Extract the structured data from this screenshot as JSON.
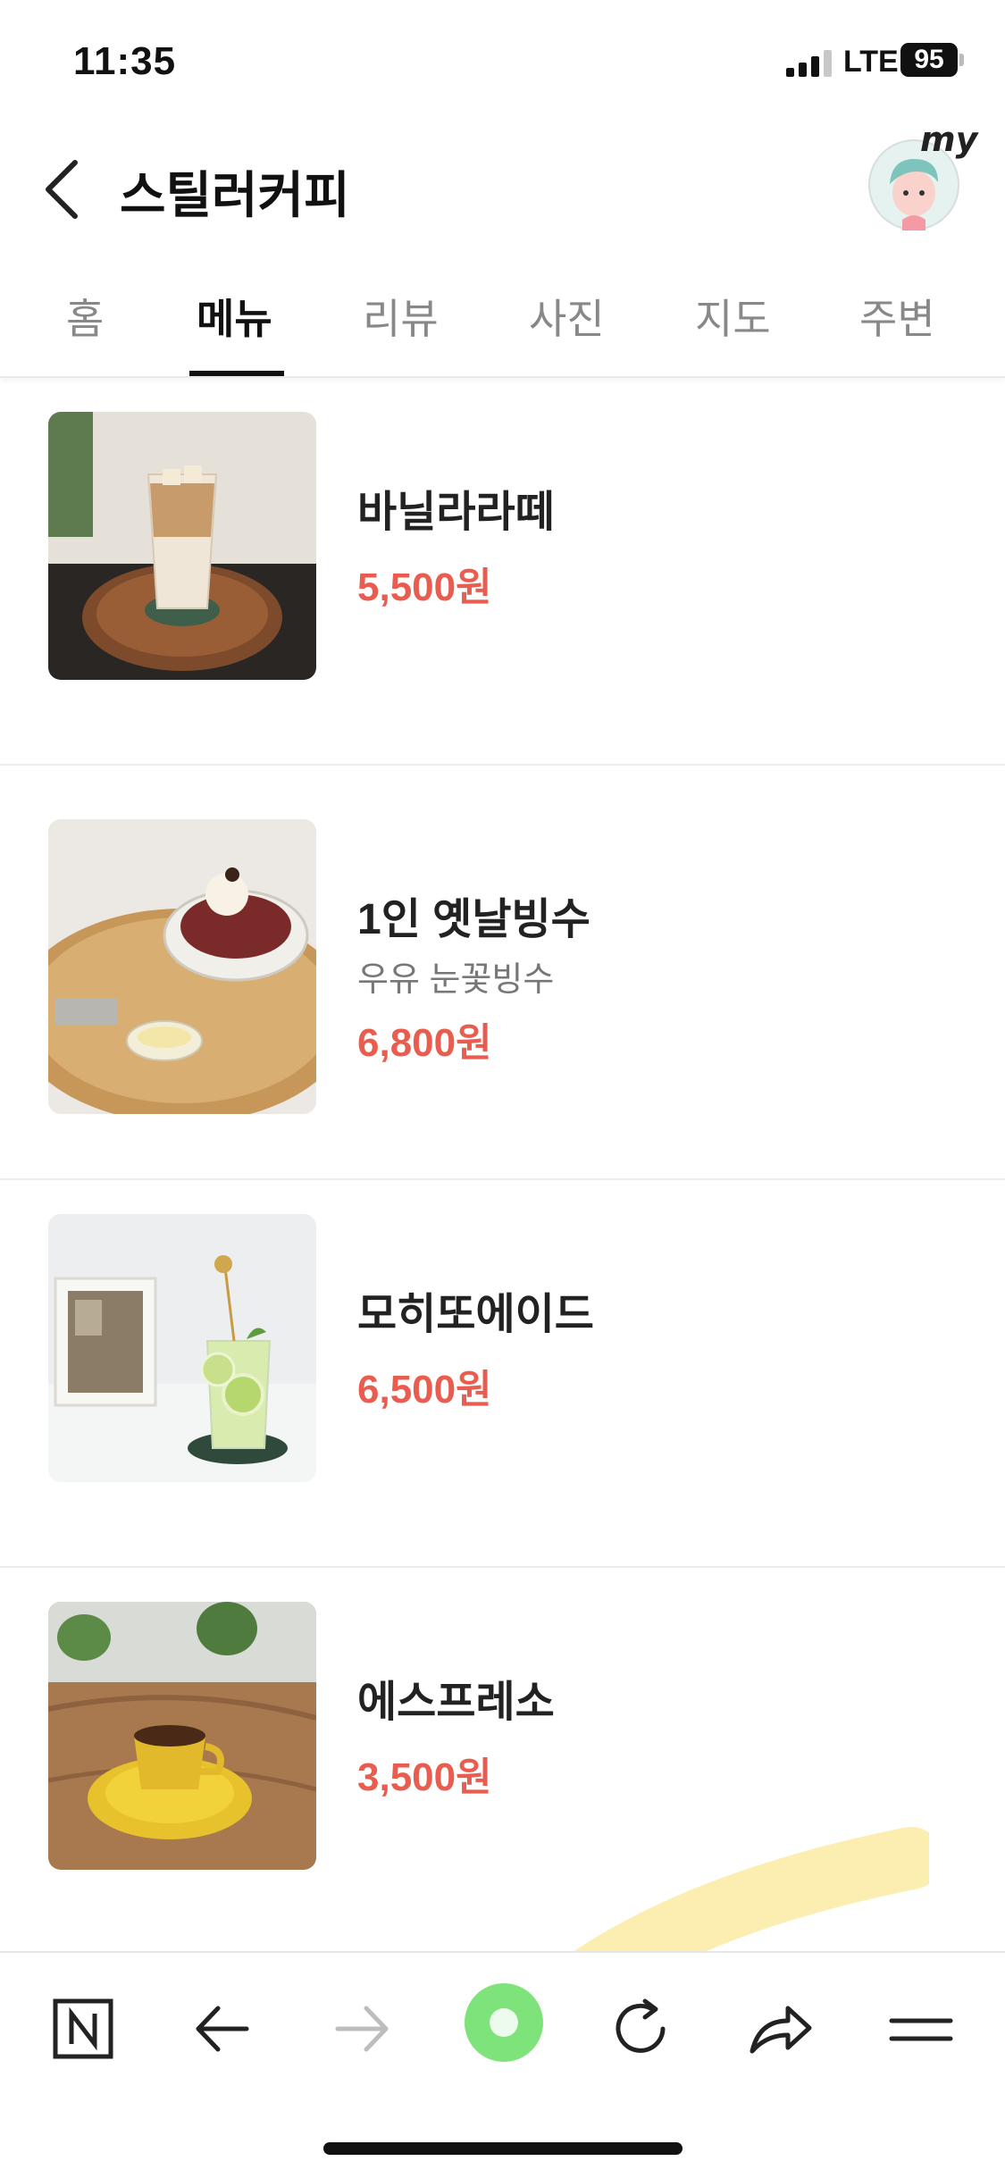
{
  "status_bar": {
    "time": "11:35",
    "network": "LTE",
    "battery": "95"
  },
  "header": {
    "title": "스틸러커피",
    "back_icon": "chevron-left-icon",
    "profile_badge": "my"
  },
  "tabs": [
    {
      "label": "홈",
      "active": false
    },
    {
      "label": "메뉴",
      "active": true
    },
    {
      "label": "리뷰",
      "active": false
    },
    {
      "label": "사진",
      "active": false
    },
    {
      "label": "지도",
      "active": false
    },
    {
      "label": "주변",
      "active": false
    }
  ],
  "menu": [
    {
      "name": "바닐라라떼",
      "description": "",
      "price": "5,500원",
      "image": "iced-latte-photo"
    },
    {
      "name": "1인 옛날빙수",
      "description": "우유 눈꽃빙수",
      "price": "6,800원",
      "image": "bingsu-photo"
    },
    {
      "name": "모히또에이드",
      "description": "",
      "price": "6,500원",
      "image": "mojito-ade-photo"
    },
    {
      "name": "에스프레소",
      "description": "",
      "price": "3,500원",
      "image": "espresso-photo"
    }
  ],
  "bottom_bar": [
    "naver-logo-icon",
    "back-arrow-icon",
    "forward-arrow-icon",
    "green-dot-icon",
    "reload-icon",
    "share-icon",
    "menu-icon"
  ],
  "colors": {
    "price": "#e85d4f",
    "active_tab": "#111111",
    "inactive_tab": "#888888",
    "green_button": "#7ee37a"
  }
}
